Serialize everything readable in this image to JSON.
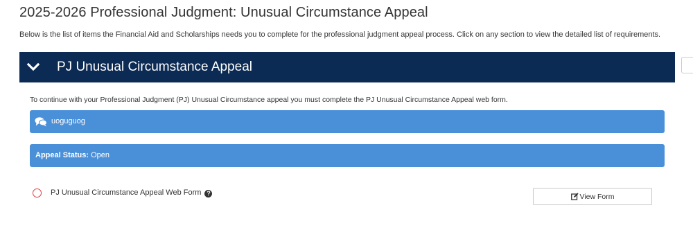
{
  "page": {
    "title": "2025-2026 Professional Judgment: Unusual Circumstance Appeal",
    "intro": "Below is the list of items the Financial Aid and Scholarships needs you to complete for the professional judgment appeal process. Click on any section to view the detailed list of requirements."
  },
  "section": {
    "title": "PJ Unusual Circumstance Appeal",
    "toggle_icon": "chevron-down-icon",
    "expanded": true,
    "instructions": "To continue with your Professional Judgment (PJ) Unusual Circumstance appeal you must complete the PJ Unusual Circumstance Appeal web form.",
    "message": {
      "icon": "comments-icon",
      "text": "uoguguog"
    },
    "status": {
      "label": "Appeal Status:",
      "value": "Open"
    },
    "requirements": [
      {
        "label": "PJ Unusual Circumstance Appeal Web Form",
        "status_icon": "incomplete-circle-icon",
        "help_icon": "question-circle-icon",
        "button_label": "View Form",
        "button_icon": "edit-icon"
      }
    ]
  },
  "colors": {
    "header_bg": "#0b2a54",
    "info_bar_bg": "#4a90d9",
    "incomplete": "#e03c3c",
    "text": "#333333"
  }
}
